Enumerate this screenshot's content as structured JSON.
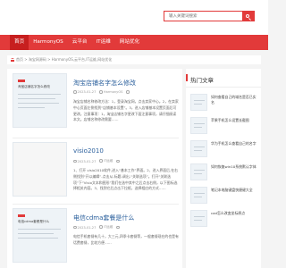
{
  "search": {
    "placeholder": "输入关键词搜索"
  },
  "nav": {
    "items": [
      {
        "label": "首页",
        "active": true
      },
      {
        "label": "HarmonyOS",
        "active": false
      },
      {
        "label": "云平台",
        "active": false
      },
      {
        "label": "IT运维",
        "active": false
      },
      {
        "label": "网站优化",
        "active": false
      }
    ]
  },
  "breadcrumb": {
    "text": "首页 > 淘宝网源码 > HarmonyOS,云平台,IT运维,网站优化"
  },
  "articles": [
    {
      "title": "淘宝店铺名字怎么修改",
      "date": "2023-01-27",
      "category": "HarmonyOS",
      "views": "",
      "text": "淘宝店铺名称修改方法：1，登录淘宝网，点击卖家中心。2，在卖家中心页面左侧找到“店铺基本设置”。3，进入店铺基本设置页面后可更改。注意事项：1，淘宝店铺名字更改下面注意事项，请仔细阅读本文。店铺名称修改需要……",
      "thumb_title": "淘宝店铺名字怎么修改"
    },
    {
      "title": "visio2010",
      "date": "2023-01-27",
      "category": "IT运维",
      "views": "",
      "text": "1、打开 visio2010软件,进入“基本工作”界面。2、进入界面后,在右侧找到“开以编辑”-点击从-标题-调出-“关联选项”。打开“关联选项”下“Visio文本和图形”我们在选中其中之后点击右侧，以下图标选择相关内容。3、找到它后点击下拉框，选择相应的方式……",
      "thumb_title": ""
    },
    {
      "title": "电信cdma套餐是什么",
      "date": "2023-01-27",
      "category": "IT运维",
      "views": "",
      "text": "电信手机套餐有几十，大三元,四季卡套餐等，一般套餐现在的也是有话费套餐，比较方便……",
      "thumb_title": "电信cdma套餐是什么"
    }
  ],
  "sidebar": {
    "title": "热门文章",
    "items": [
      {
        "text": "如何查看自己的域名是否已实名"
      },
      {
        "text": "苹果手机怎么设置长截图"
      },
      {
        "text": "华为手机怎么查看自己的名字"
      },
      {
        "text": "如何恢复win10系统默认字体"
      },
      {
        "text": "笔记本电脑键盘快捷键大全"
      },
      {
        "text": "cad怎么改变坐标原点"
      }
    ]
  },
  "colors": {
    "accent": "#e23a3a",
    "link": "#2a5f9c"
  }
}
